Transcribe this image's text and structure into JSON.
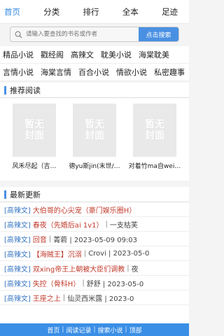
{
  "nav": [
    "首页",
    "分类",
    "排行",
    "全本",
    "足迹"
  ],
  "search": {
    "placeholder": "请输入要查找的书名或作者",
    "button": "点击搜索"
  },
  "categories": {
    "row1": [
      "精品小说",
      "戳经阁",
      "高辣文",
      "耽美小说",
      "海棠耽美"
    ],
    "row2": [
      "言情小说",
      "海棠言情",
      "百合小说",
      "情欲小说",
      "私密趣事"
    ]
  },
  "recommend": {
    "title": "推荐阅读",
    "cover_text": [
      "暂无",
      "封面"
    ],
    "books": [
      "风禾尽起（吉…",
      "德yu斯jin(末世/…",
      "对着竹ma自wei…"
    ]
  },
  "updates": {
    "title": "最新更新",
    "rows": [
      {
        "cat": "[高辣文]",
        "title": "大伯哥的心尖宠（豪门娱乐圈H）",
        "extra": ""
      },
      {
        "cat": "[高辣文]",
        "title": "春夜（先婚后ai 1v1）",
        "extra": "一支枯芙"
      },
      {
        "cat": "[高辣文]",
        "title": "回音",
        "extra": "菁菪 | 2023-05-09 09:03"
      },
      {
        "cat": "[高辣文]",
        "title": "【海贼王】沉溺",
        "extra": "Crovi | 2023-05-0"
      },
      {
        "cat": "[高辣文]",
        "title": "双xing帝王上朝被大臣们调教",
        "extra": "夜"
      },
      {
        "cat": "[高辣文]",
        "title": "失控（骨科H）",
        "extra": "舒舒 | 2023-05-0"
      },
      {
        "cat": "[高辣文]",
        "title": "王座之上",
        "extra": "仙灵西米露 | 2023-0"
      }
    ]
  },
  "footer": [
    "首页",
    "阅读记录",
    "搜索小说",
    "顶部"
  ],
  "colors": {
    "accent": "#3a8ee6",
    "button": "#4a90e2",
    "title_red": "#c0392b",
    "cat_blue": "#3a78c3"
  }
}
